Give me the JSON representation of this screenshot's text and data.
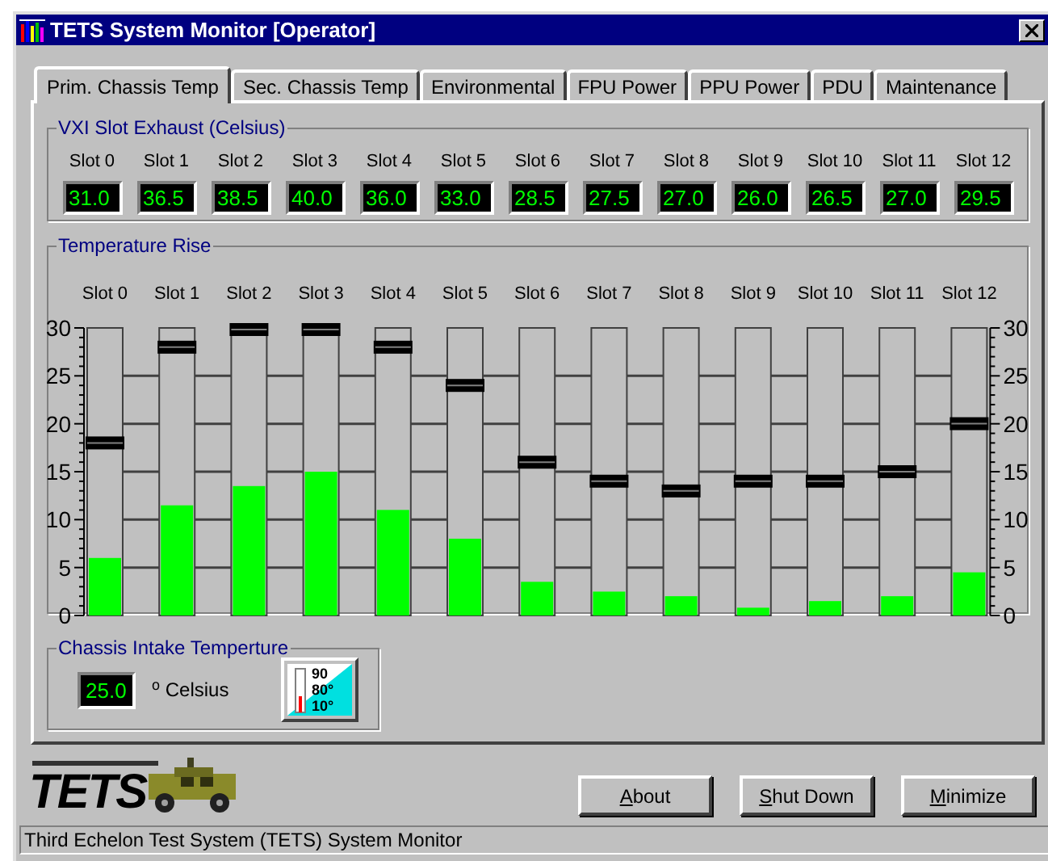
{
  "window": {
    "title": "TETS System Monitor [Operator]"
  },
  "tabs": [
    {
      "label": "Prim. Chassis Temp",
      "selected": true
    },
    {
      "label": "Sec. Chassis Temp",
      "selected": false
    },
    {
      "label": "Environmental",
      "selected": false
    },
    {
      "label": "FPU Power",
      "selected": false
    },
    {
      "label": "PPU Power",
      "selected": false
    },
    {
      "label": "PDU",
      "selected": false
    },
    {
      "label": "Maintenance",
      "selected": false
    }
  ],
  "exhaust": {
    "title": "VXI Slot Exhaust (Celsius)",
    "slots": [
      {
        "label": "Slot 0",
        "value": "31.0"
      },
      {
        "label": "Slot 1",
        "value": "36.5"
      },
      {
        "label": "Slot 2",
        "value": "38.5"
      },
      {
        "label": "Slot 3",
        "value": "40.0"
      },
      {
        "label": "Slot 4",
        "value": "36.0"
      },
      {
        "label": "Slot 5",
        "value": "33.0"
      },
      {
        "label": "Slot 6",
        "value": "28.5"
      },
      {
        "label": "Slot 7",
        "value": "27.5"
      },
      {
        "label": "Slot 8",
        "value": "27.0"
      },
      {
        "label": "Slot 9",
        "value": "26.0"
      },
      {
        "label": "Slot 10",
        "value": "26.5"
      },
      {
        "label": "Slot 11",
        "value": "27.0"
      },
      {
        "label": "Slot 12",
        "value": "29.5"
      }
    ]
  },
  "temperature_rise": {
    "title": "Temperature Rise",
    "left_scale": [
      "30",
      "25",
      "20",
      "15",
      "10",
      "5",
      "0"
    ],
    "right_scale": [
      "30",
      "25",
      "20",
      "15",
      "10",
      "5",
      "0"
    ],
    "slots": [
      {
        "label": "Slot 0",
        "meter": {
          "level": 0.2
        },
        "thumb": {
          "level": 0.6
        }
      },
      {
        "label": "Slot 1",
        "meter": {
          "level": 0.383
        },
        "thumb": {
          "level": 0.933
        }
      },
      {
        "label": "Slot 2",
        "meter": {
          "level": 0.45
        },
        "thumb": {
          "level": 1
        }
      },
      {
        "label": "Slot 3",
        "meter": {
          "level": 0.5
        },
        "thumb": {
          "level": 1
        }
      },
      {
        "label": "Slot 4",
        "meter": {
          "level": 0.367
        },
        "thumb": {
          "level": 0.933
        }
      },
      {
        "label": "Slot 5",
        "meter": {
          "level": 0.267
        },
        "thumb": {
          "level": 0.8
        }
      },
      {
        "label": "Slot 6",
        "meter": {
          "level": 0.117
        },
        "thumb": {
          "level": 0.533
        }
      },
      {
        "label": "Slot 7",
        "meter": {
          "level": 0.083
        },
        "thumb": {
          "level": 0.467
        }
      },
      {
        "label": "Slot 8",
        "meter": {
          "level": 0.067
        },
        "thumb": {
          "level": 0.433
        }
      },
      {
        "label": "Slot 9",
        "meter": {
          "level": 0.027
        },
        "thumb": {
          "level": 0.467
        }
      },
      {
        "label": "Slot 10",
        "meter": {
          "level": 0.05
        },
        "thumb": {
          "level": 0.467
        }
      },
      {
        "label": "Slot 11",
        "meter": {
          "level": 0.067
        },
        "thumb": {
          "level": 0.5
        }
      },
      {
        "label": "Slot 12",
        "meter": {
          "level": 0.15
        },
        "thumb": {
          "level": 0.667
        }
      }
    ]
  },
  "intake": {
    "title": "Chassis Intake Temperture",
    "value": "25.0",
    "unit": "$^{o}$ Celsius",
    "icon_labels": [
      "90",
      "80°",
      "10°"
    ]
  },
  "logo": {
    "text": "TETS"
  },
  "buttons": [
    {
      "mnemonic": "A",
      "label": "bout"
    },
    {
      "mnemonic": "S",
      "label": "hut Down"
    },
    {
      "mnemonic": "M",
      "label": "inimize"
    }
  ],
  "status_bar": "Third Echelon Test System (TETS) System Monitor"
}
